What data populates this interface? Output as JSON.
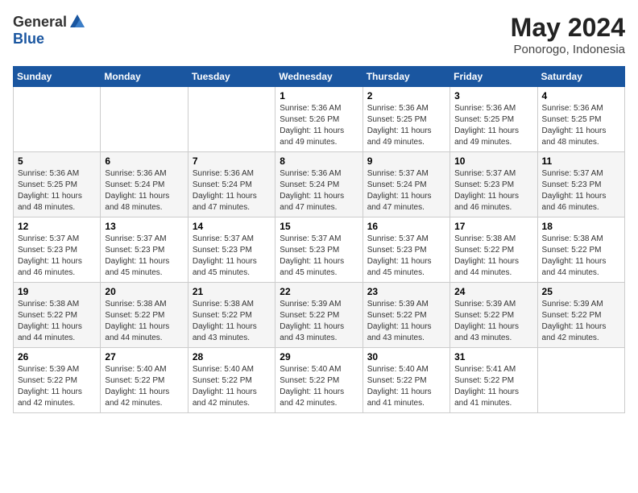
{
  "header": {
    "logo_general": "General",
    "logo_blue": "Blue",
    "month_year": "May 2024",
    "location": "Ponorogo, Indonesia"
  },
  "weekdays": [
    "Sunday",
    "Monday",
    "Tuesday",
    "Wednesday",
    "Thursday",
    "Friday",
    "Saturday"
  ],
  "weeks": [
    [
      {
        "day": "",
        "info": ""
      },
      {
        "day": "",
        "info": ""
      },
      {
        "day": "",
        "info": ""
      },
      {
        "day": "1",
        "info": "Sunrise: 5:36 AM\nSunset: 5:26 PM\nDaylight: 11 hours\nand 49 minutes."
      },
      {
        "day": "2",
        "info": "Sunrise: 5:36 AM\nSunset: 5:25 PM\nDaylight: 11 hours\nand 49 minutes."
      },
      {
        "day": "3",
        "info": "Sunrise: 5:36 AM\nSunset: 5:25 PM\nDaylight: 11 hours\nand 49 minutes."
      },
      {
        "day": "4",
        "info": "Sunrise: 5:36 AM\nSunset: 5:25 PM\nDaylight: 11 hours\nand 48 minutes."
      }
    ],
    [
      {
        "day": "5",
        "info": "Sunrise: 5:36 AM\nSunset: 5:25 PM\nDaylight: 11 hours\nand 48 minutes."
      },
      {
        "day": "6",
        "info": "Sunrise: 5:36 AM\nSunset: 5:24 PM\nDaylight: 11 hours\nand 48 minutes."
      },
      {
        "day": "7",
        "info": "Sunrise: 5:36 AM\nSunset: 5:24 PM\nDaylight: 11 hours\nand 47 minutes."
      },
      {
        "day": "8",
        "info": "Sunrise: 5:36 AM\nSunset: 5:24 PM\nDaylight: 11 hours\nand 47 minutes."
      },
      {
        "day": "9",
        "info": "Sunrise: 5:37 AM\nSunset: 5:24 PM\nDaylight: 11 hours\nand 47 minutes."
      },
      {
        "day": "10",
        "info": "Sunrise: 5:37 AM\nSunset: 5:23 PM\nDaylight: 11 hours\nand 46 minutes."
      },
      {
        "day": "11",
        "info": "Sunrise: 5:37 AM\nSunset: 5:23 PM\nDaylight: 11 hours\nand 46 minutes."
      }
    ],
    [
      {
        "day": "12",
        "info": "Sunrise: 5:37 AM\nSunset: 5:23 PM\nDaylight: 11 hours\nand 46 minutes."
      },
      {
        "day": "13",
        "info": "Sunrise: 5:37 AM\nSunset: 5:23 PM\nDaylight: 11 hours\nand 45 minutes."
      },
      {
        "day": "14",
        "info": "Sunrise: 5:37 AM\nSunset: 5:23 PM\nDaylight: 11 hours\nand 45 minutes."
      },
      {
        "day": "15",
        "info": "Sunrise: 5:37 AM\nSunset: 5:23 PM\nDaylight: 11 hours\nand 45 minutes."
      },
      {
        "day": "16",
        "info": "Sunrise: 5:37 AM\nSunset: 5:23 PM\nDaylight: 11 hours\nand 45 minutes."
      },
      {
        "day": "17",
        "info": "Sunrise: 5:38 AM\nSunset: 5:22 PM\nDaylight: 11 hours\nand 44 minutes."
      },
      {
        "day": "18",
        "info": "Sunrise: 5:38 AM\nSunset: 5:22 PM\nDaylight: 11 hours\nand 44 minutes."
      }
    ],
    [
      {
        "day": "19",
        "info": "Sunrise: 5:38 AM\nSunset: 5:22 PM\nDaylight: 11 hours\nand 44 minutes."
      },
      {
        "day": "20",
        "info": "Sunrise: 5:38 AM\nSunset: 5:22 PM\nDaylight: 11 hours\nand 44 minutes."
      },
      {
        "day": "21",
        "info": "Sunrise: 5:38 AM\nSunset: 5:22 PM\nDaylight: 11 hours\nand 43 minutes."
      },
      {
        "day": "22",
        "info": "Sunrise: 5:39 AM\nSunset: 5:22 PM\nDaylight: 11 hours\nand 43 minutes."
      },
      {
        "day": "23",
        "info": "Sunrise: 5:39 AM\nSunset: 5:22 PM\nDaylight: 11 hours\nand 43 minutes."
      },
      {
        "day": "24",
        "info": "Sunrise: 5:39 AM\nSunset: 5:22 PM\nDaylight: 11 hours\nand 43 minutes."
      },
      {
        "day": "25",
        "info": "Sunrise: 5:39 AM\nSunset: 5:22 PM\nDaylight: 11 hours\nand 42 minutes."
      }
    ],
    [
      {
        "day": "26",
        "info": "Sunrise: 5:39 AM\nSunset: 5:22 PM\nDaylight: 11 hours\nand 42 minutes."
      },
      {
        "day": "27",
        "info": "Sunrise: 5:40 AM\nSunset: 5:22 PM\nDaylight: 11 hours\nand 42 minutes."
      },
      {
        "day": "28",
        "info": "Sunrise: 5:40 AM\nSunset: 5:22 PM\nDaylight: 11 hours\nand 42 minutes."
      },
      {
        "day": "29",
        "info": "Sunrise: 5:40 AM\nSunset: 5:22 PM\nDaylight: 11 hours\nand 42 minutes."
      },
      {
        "day": "30",
        "info": "Sunrise: 5:40 AM\nSunset: 5:22 PM\nDaylight: 11 hours\nand 41 minutes."
      },
      {
        "day": "31",
        "info": "Sunrise: 5:41 AM\nSunset: 5:22 PM\nDaylight: 11 hours\nand 41 minutes."
      },
      {
        "day": "",
        "info": ""
      }
    ]
  ]
}
